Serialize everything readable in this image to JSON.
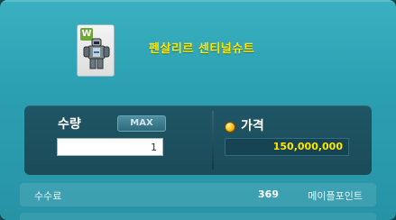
{
  "item": {
    "badge": "W",
    "name": "펜살리르 센티널슈트",
    "icon": "armor-suit-icon"
  },
  "order": {
    "quantity_label": "수량",
    "max_label": "MAX",
    "quantity_value": "1",
    "price_label": "가격",
    "price_icon": "gold-coin-icon",
    "price_value": "150,000,000"
  },
  "fee": {
    "label": "수수료",
    "value": "369",
    "unit": "메이플포인트"
  },
  "colors": {
    "accent_yellow": "#ffe600",
    "panel_teal": "#2aa0b2",
    "dark_box": "#1b4b59"
  }
}
